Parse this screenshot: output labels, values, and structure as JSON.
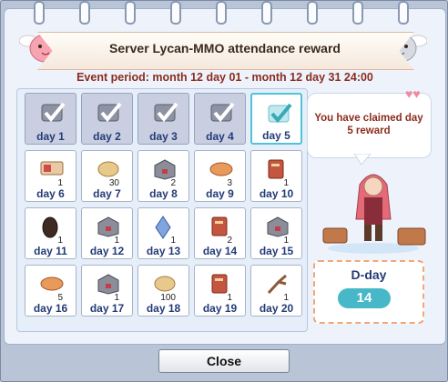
{
  "window": {
    "title": "Server Lycan-MMO attendance reward",
    "event_period": "Event period: month 12 day 01 -  month 12 day 31 24:00"
  },
  "message": "You have claimed day 5 reward",
  "dday": {
    "label": "D-day",
    "value": "14"
  },
  "close_label": "Close",
  "days": [
    {
      "label": "day 1",
      "qty": "",
      "icon": "check-icon",
      "state": "claimed"
    },
    {
      "label": "day 2",
      "qty": "",
      "icon": "check-icon",
      "state": "claimed"
    },
    {
      "label": "day 3",
      "qty": "",
      "icon": "check-icon",
      "state": "claimed"
    },
    {
      "label": "day 4",
      "qty": "",
      "icon": "check-icon",
      "state": "claimed"
    },
    {
      "label": "day 5",
      "qty": "",
      "icon": "check-icon",
      "state": "current"
    },
    {
      "label": "day 6",
      "qty": "1",
      "icon": "ticket-icon",
      "state": "open"
    },
    {
      "label": "day 7",
      "qty": "30",
      "icon": "bread-icon",
      "state": "open"
    },
    {
      "label": "day 8",
      "qty": "2",
      "icon": "box-icon",
      "state": "open"
    },
    {
      "label": "day 9",
      "qty": "3",
      "icon": "loaf-icon",
      "state": "open"
    },
    {
      "label": "day 10",
      "qty": "1",
      "icon": "book-icon",
      "state": "open"
    },
    {
      "label": "day 11",
      "qty": "1",
      "icon": "seed-icon",
      "state": "open"
    },
    {
      "label": "day 12",
      "qty": "1",
      "icon": "box-icon",
      "state": "open"
    },
    {
      "label": "day 13",
      "qty": "1",
      "icon": "crystal-icon",
      "state": "open"
    },
    {
      "label": "day 14",
      "qty": "2",
      "icon": "book-icon",
      "state": "open"
    },
    {
      "label": "day 15",
      "qty": "1",
      "icon": "box-icon",
      "state": "open"
    },
    {
      "label": "day 16",
      "qty": "5",
      "icon": "loaf-icon",
      "state": "open"
    },
    {
      "label": "day 17",
      "qty": "1",
      "icon": "box-icon",
      "state": "open"
    },
    {
      "label": "day 18",
      "qty": "100",
      "icon": "bread-icon",
      "state": "open"
    },
    {
      "label": "day 19",
      "qty": "1",
      "icon": "book-icon",
      "state": "open"
    },
    {
      "label": "day 20",
      "qty": "1",
      "icon": "branch-icon",
      "state": "open"
    }
  ]
}
